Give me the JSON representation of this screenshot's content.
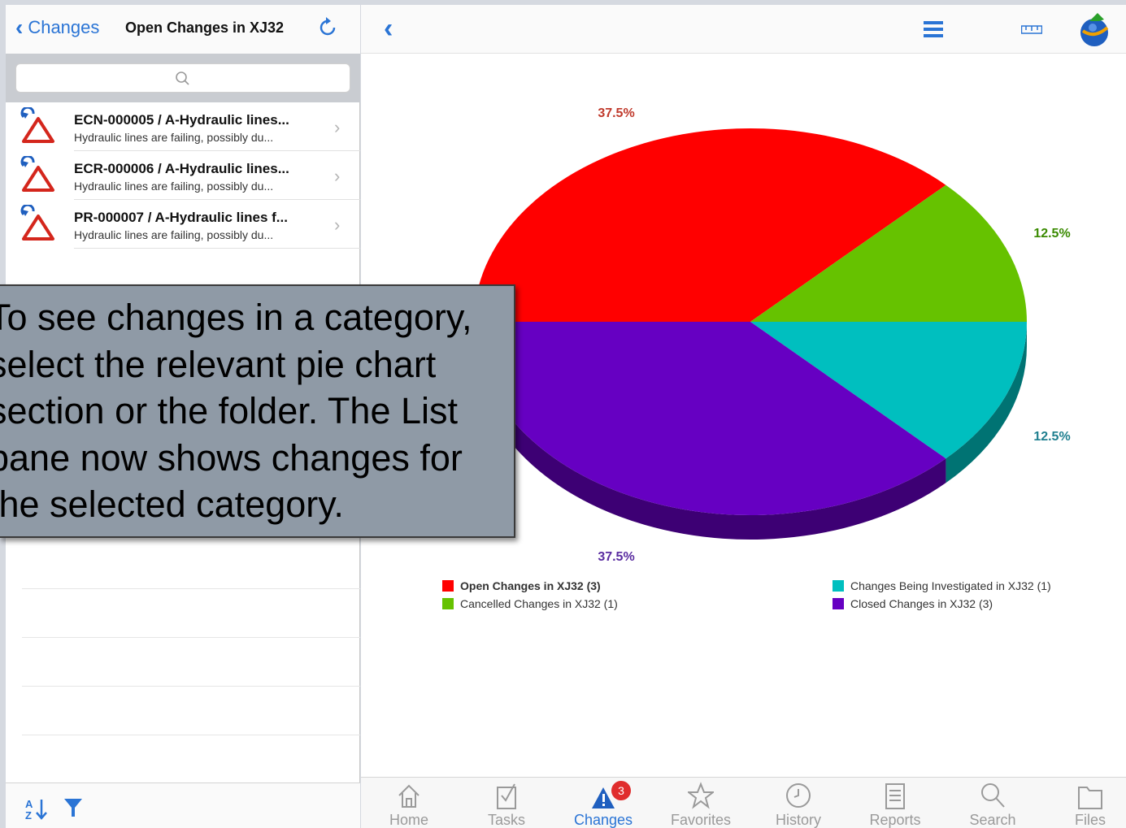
{
  "left_pane": {
    "back_label": "Changes",
    "title": "Open Changes in XJ32",
    "items": [
      {
        "title": "ECN-000005 / A-Hydraulic lines...",
        "subtitle": "Hydraulic lines are failing, possibly du..."
      },
      {
        "title": "ECR-000006 / A-Hydraulic lines...",
        "subtitle": "Hydraulic lines are failing, possibly du..."
      },
      {
        "title": "PR-000007 / A-Hydraulic lines f...",
        "subtitle": "Hydraulic lines are failing, possibly du..."
      }
    ]
  },
  "callout": {
    "text": "To see changes in a category,\nselect the relevant pie chart\nsection or the folder.  The List\npane now shows changes for\nthe selected category."
  },
  "tabbar": {
    "tabs": [
      {
        "label": "Home",
        "icon": "home-icon"
      },
      {
        "label": "Tasks",
        "icon": "tasks-icon"
      },
      {
        "label": "Changes",
        "icon": "changes-icon",
        "active": true,
        "badge": "3"
      },
      {
        "label": "Favorites",
        "icon": "star-icon"
      },
      {
        "label": "History",
        "icon": "clock-icon"
      },
      {
        "label": "Reports",
        "icon": "reports-icon"
      },
      {
        "label": "Search",
        "icon": "search-icon"
      },
      {
        "label": "Files",
        "icon": "folder-icon"
      }
    ]
  },
  "chart_data": {
    "type": "pie",
    "slices": [
      {
        "label": "Open Changes in XJ32 (3)",
        "value": 3,
        "percent_label": "37.5%",
        "color": "#ff0000",
        "label_color": "#c0392b"
      },
      {
        "label": "Cancelled Changes in XJ32 (1)",
        "value": 1,
        "percent_label": "12.5%",
        "color": "#66c200",
        "label_color": "#3a8a00"
      },
      {
        "label": "Changes Being Investigated in XJ32 (1)",
        "value": 1,
        "percent_label": "12.5%",
        "color": "#00bfbf",
        "label_color": "#1f7f8f"
      },
      {
        "label": "Closed Changes in XJ32 (3)",
        "value": 3,
        "percent_label": "37.5%",
        "color": "#6600c2",
        "label_color": "#5a2ca0"
      }
    ],
    "legend": [
      {
        "label": "Open Changes in XJ32 (3)",
        "color": "#ff0000"
      },
      {
        "label": "Cancelled Changes in XJ32 (1)",
        "color": "#66c200"
      },
      {
        "label": "Changes Being Investigated in XJ32 (1)",
        "color": "#00bfbf"
      },
      {
        "label": "Closed Changes in XJ32 (3)",
        "color": "#6600c2"
      }
    ],
    "legend_position": "bottom"
  }
}
